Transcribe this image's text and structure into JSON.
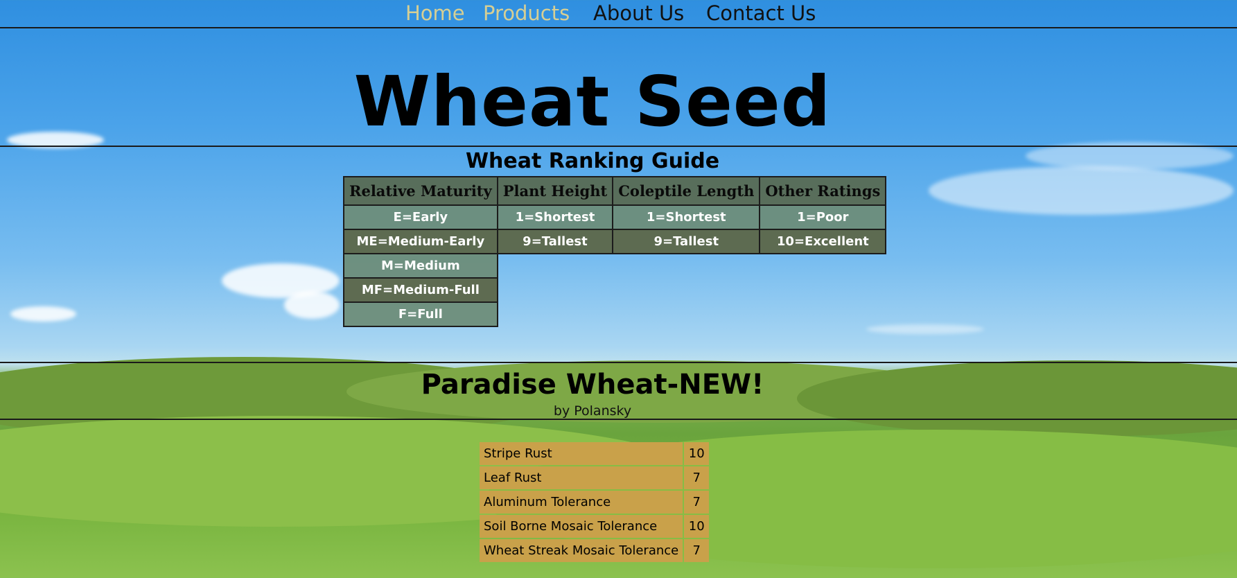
{
  "nav": {
    "items": [
      {
        "label": "Home",
        "active": true
      },
      {
        "label": "Products",
        "active": true
      },
      {
        "label": "About Us",
        "active": false
      },
      {
        "label": "Contact Us",
        "active": false
      }
    ]
  },
  "page_title": "Wheat Seed",
  "guide": {
    "title": "Wheat Ranking Guide",
    "headers": [
      "Relative Maturity",
      "Plant Height",
      "Coleptile Length",
      "Other Ratings"
    ],
    "rows": [
      [
        "E=Early",
        "1=Shortest",
        "1=Shortest",
        "1=Poor"
      ],
      [
        "ME=Medium-Early",
        "9=Tallest",
        "9=Tallest",
        "10=Excellent"
      ],
      [
        "M=Medium",
        "",
        "",
        ""
      ],
      [
        "MF=Medium-Full",
        "",
        "",
        ""
      ],
      [
        "F=Full",
        "",
        "",
        ""
      ]
    ]
  },
  "product": {
    "title": "Paradise Wheat-NEW!",
    "by": "by Polansky",
    "ratings": [
      {
        "name": "Stripe Rust",
        "value": "10"
      },
      {
        "name": "Leaf Rust",
        "value": "7"
      },
      {
        "name": "Aluminum Tolerance",
        "value": "7"
      },
      {
        "name": "Soil Borne Mosaic Tolerance",
        "value": "10"
      },
      {
        "name": "Wheat Streak Mosaic Tolerance",
        "value": "7"
      }
    ]
  },
  "colors": {
    "nav_active": "#d6cf94",
    "header_cell": "#58684e",
    "cell_light": "#6c8c76",
    "cell_dark": "#5c6648",
    "rating_cell": "#c9a14a"
  }
}
